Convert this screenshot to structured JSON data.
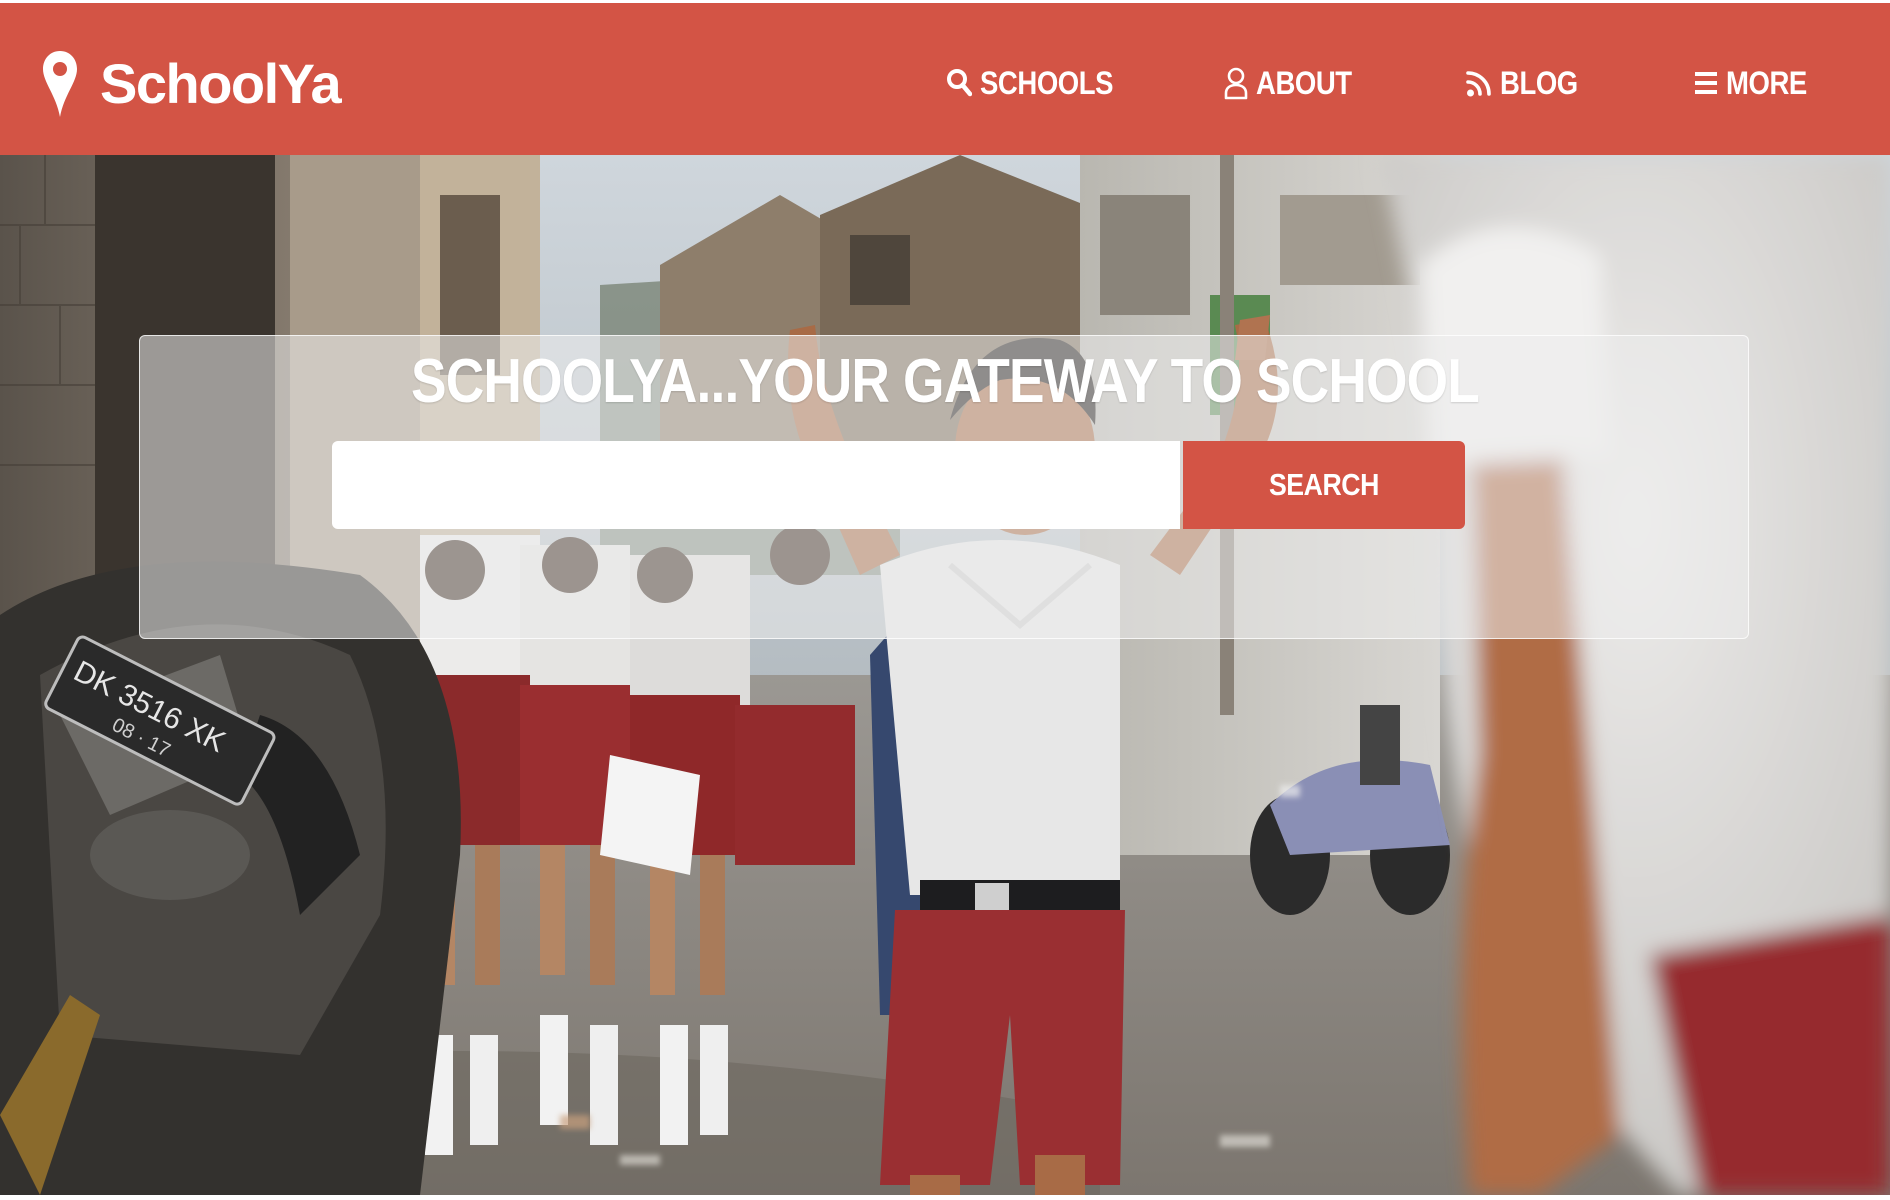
{
  "brand": {
    "name": "SchoolYa",
    "icon": "map-pin-icon"
  },
  "nav": {
    "items": [
      {
        "label": "SCHOOLS",
        "icon": "search-icon"
      },
      {
        "label": "ABOUT",
        "icon": "user-icon"
      },
      {
        "label": "BLOG",
        "icon": "rss-icon"
      },
      {
        "label": "MORE",
        "icon": "menu-icon"
      }
    ]
  },
  "hero": {
    "tagline": "SCHOOLYA...YOUR GATEWAY TO SCHOOL",
    "search": {
      "value": "",
      "placeholder": "",
      "button_label": "SEARCH"
    },
    "photo": {
      "plate_text": "DK 3516 XK",
      "plate_sub": "08 · 17"
    }
  },
  "colors": {
    "accent": "#d35445",
    "text_on_accent": "#ffffff"
  }
}
